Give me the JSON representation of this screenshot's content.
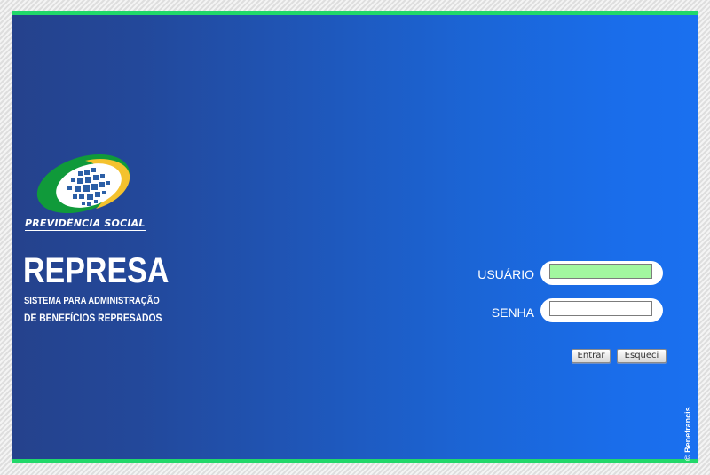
{
  "logo": {
    "text": "PREVIDÊNCIA SOCIAL",
    "colors": {
      "green": "#109a3a",
      "yellow": "#f4c22e",
      "white": "#ffffff",
      "blue": "#2c5fa6"
    }
  },
  "app": {
    "title": "REPRESA",
    "subtitle_line1": "SISTEMA PARA ADMINISTRAÇÃO",
    "subtitle_line2": "DE BENEFÍCIOS REPRESADOS"
  },
  "login": {
    "user_label": "USUÁRIO",
    "user_value": "",
    "password_label": "SENHA",
    "password_value": "",
    "enter_button": "Entrar",
    "forgot_button": "Esqueci"
  },
  "footer": {
    "copyright": "© Benefrancis"
  },
  "theme": {
    "accent_green": "#21d86a",
    "bg_left": "#25428c",
    "bg_right": "#1a70f0",
    "focused_input": "#a2f79f"
  }
}
